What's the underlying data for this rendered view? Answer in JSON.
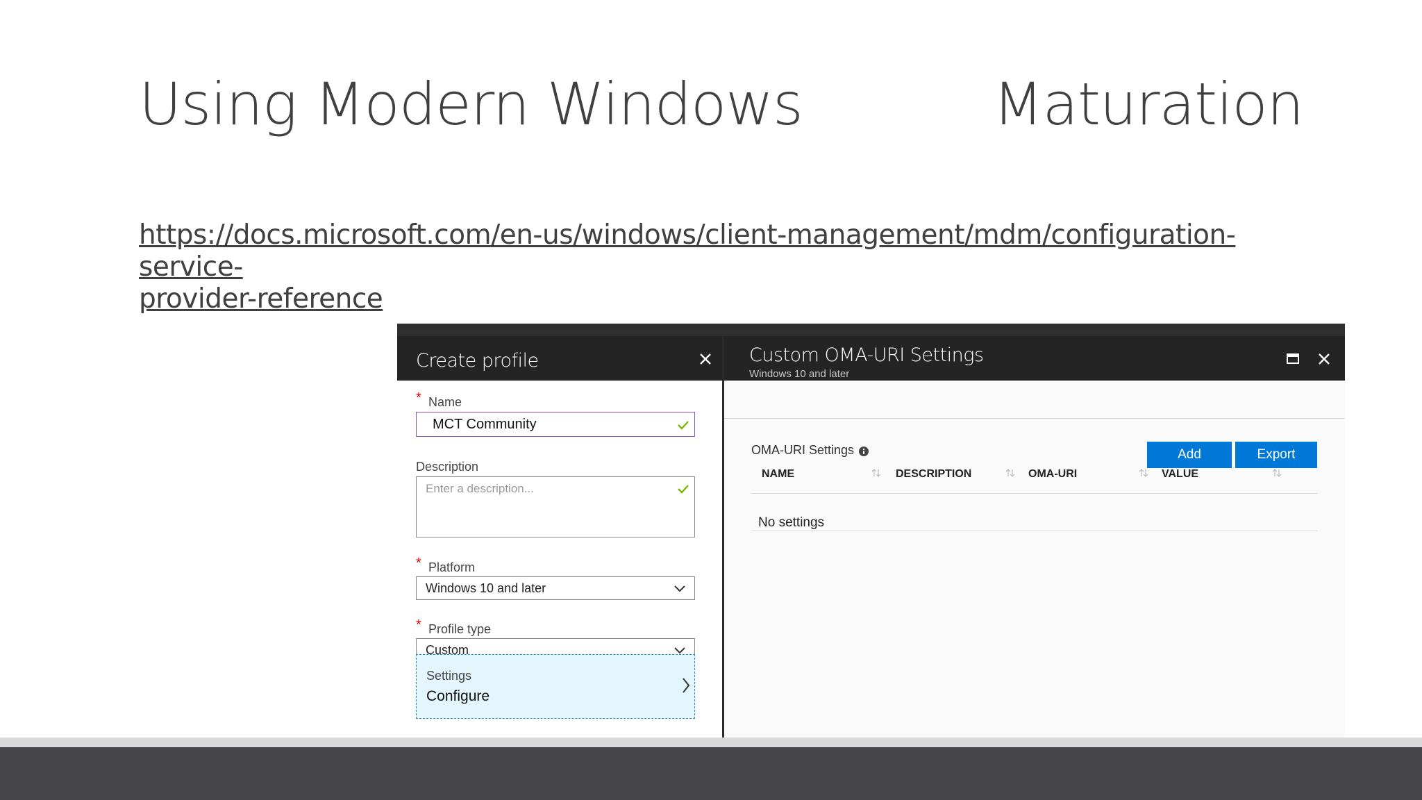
{
  "slide": {
    "title_left": "Using Modern Windows",
    "title_right": "Maturation",
    "link_line1": "https://docs.microsoft.com/en-us/windows/client-management/mdm/configuration-service-",
    "link_line2": "provider-reference"
  },
  "create_profile": {
    "title": "Create profile",
    "name_label": "Name",
    "name_value": "MCT Community",
    "description_label": "Description",
    "description_placeholder": "Enter a description...",
    "platform_label": "Platform",
    "platform_value": "Windows 10 and later",
    "profile_type_label": "Profile type",
    "profile_type_value": "Custom",
    "settings_label": "Settings",
    "settings_value": "Configure"
  },
  "oma_uri": {
    "title": "Custom OMA-URI Settings",
    "subtitle": "Windows 10 and later",
    "section_label": "OMA-URI Settings",
    "add_label": "Add",
    "export_label": "Export",
    "columns": [
      "NAME",
      "DESCRIPTION",
      "OMA-URI",
      "VALUE"
    ],
    "empty_text": "No settings"
  },
  "colors": {
    "accent_blue": "#0078d7",
    "header_dark": "#242424",
    "required_red": "#e00000",
    "valid_green": "#7ab800",
    "settings_bg": "#e3f6fd"
  }
}
